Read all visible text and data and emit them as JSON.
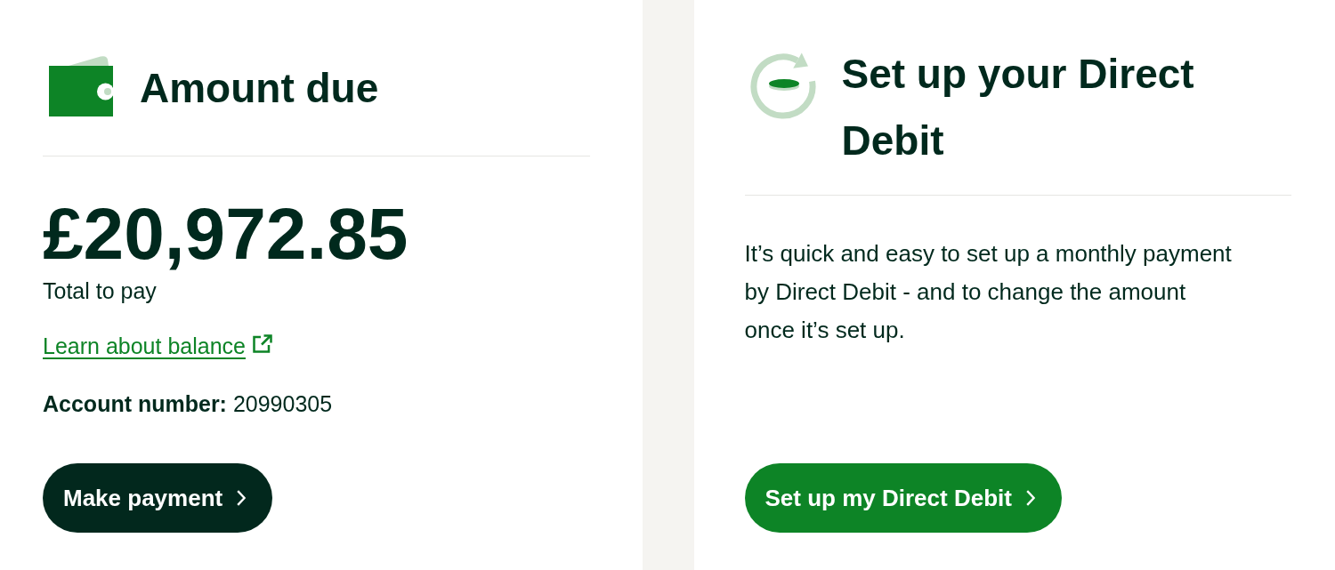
{
  "cards": [
    {
      "kind": "amount",
      "title": "Amount due",
      "amount": "£20,972.85",
      "amount_caption": "Total to pay",
      "link": {
        "label": "Learn about balance",
        "external": true
      },
      "account": "**Account number:** 20990305",
      "button": {
        "label": "Make payment",
        "kind": "dark"
      }
    },
    {
      "kind": "direct_debit",
      "title": "Set up your Direct Debit",
      "description": "It’s quick and easy to set up a monthly payment by Direct Debit - and to change the amount once it’s set up.",
      "button": {
        "label": "Set up my Direct Debit",
        "kind": "brand"
      }
    }
  ]
}
